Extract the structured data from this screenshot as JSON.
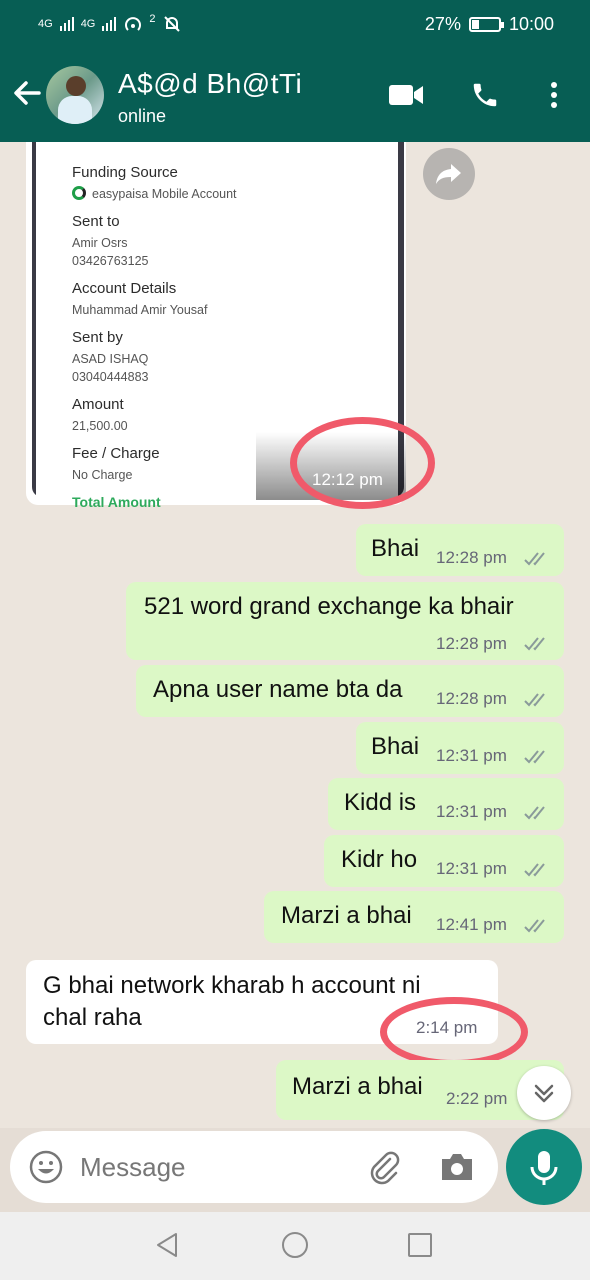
{
  "status_bar": {
    "network1": "4G",
    "network2": "4G",
    "hotspot_count": "2",
    "battery_percent": "27%",
    "battery_level": 0.27,
    "time": "10:00"
  },
  "header": {
    "contact_name": "A$@d Bh@tTi",
    "status": "online"
  },
  "receipt": {
    "funding_source_label": "Funding Source",
    "funding_source_value": "easypaisa Mobile Account",
    "sent_to_label": "Sent to",
    "sent_to_name": "Amir Osrs",
    "sent_to_number": "03426763125",
    "account_details_label": "Account Details",
    "account_details_value": "Muhammad Amir Yousaf",
    "sent_by_label": "Sent by",
    "sent_by_name": "ASAD ISHAQ",
    "sent_by_number": "03040444883",
    "amount_label": "Amount",
    "amount_value": "21,500.00",
    "fee_label": "Fee / Charge",
    "fee_value": "No Charge",
    "total_label": "Total Amount",
    "time": "12:12 pm"
  },
  "messages": [
    {
      "text": "Bhai",
      "time": "12:28 pm"
    },
    {
      "text": "521 word grand exchange ka bhair",
      "time": "12:28 pm"
    },
    {
      "text": "Apna user name bta da",
      "time": "12:28 pm"
    },
    {
      "text": "Bhai",
      "time": "12:31 pm"
    },
    {
      "text": "Kidd is",
      "time": "12:31 pm"
    },
    {
      "text": "Kidr ho",
      "time": "12:31 pm"
    },
    {
      "text": "Marzi a bhai",
      "time": "12:41 pm"
    },
    {
      "text_line1": "G bhai network kharab h account ni",
      "text_line2": "chal raha",
      "time": "2:14 pm"
    },
    {
      "text": "Marzi a bhai",
      "time": "2:22 pm"
    }
  ],
  "composer": {
    "placeholder": "Message"
  },
  "colors": {
    "header": "#075e54",
    "outgoing_bubble": "#dcf8c6",
    "incoming_bubble": "#ffffff",
    "mic_button": "#128c7e",
    "annotation_ring": "#f05a6a"
  }
}
